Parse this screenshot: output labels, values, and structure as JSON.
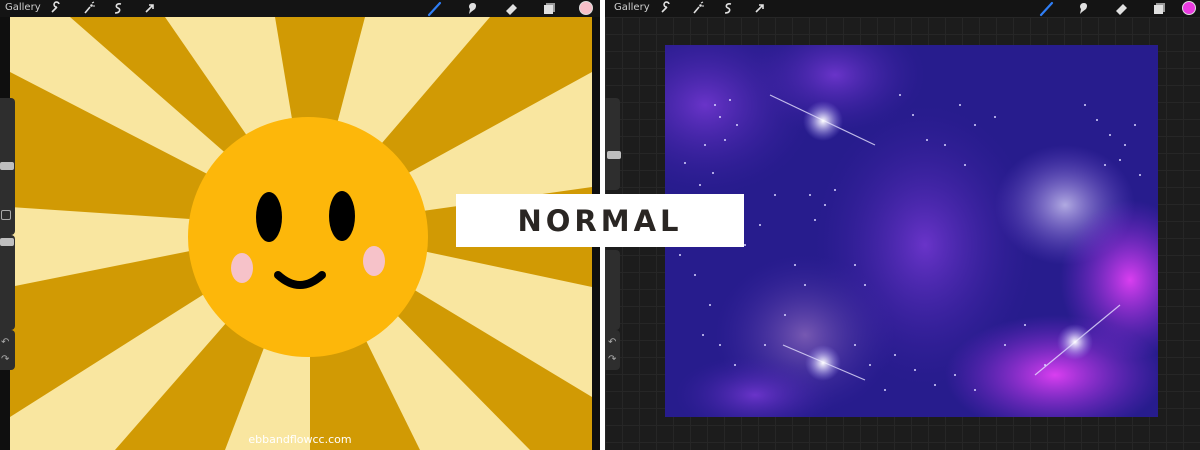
{
  "left_app": {
    "toolbar": {
      "gallery_label": "Gallery",
      "left_tools": [
        "wrench-icon",
        "magic-wand-icon",
        "selection-icon",
        "transform-arrow-icon"
      ],
      "right_tools": [
        "brush-icon",
        "smudge-icon",
        "eraser-icon",
        "layers-icon"
      ],
      "current_color": "#f7bfc8"
    },
    "canvas": {
      "background_color": "#d19a04",
      "ray_color": "#f9e6a0",
      "sun_color": "#fdb70a",
      "eye_color": "#000000",
      "cheek_color": "#f6c2c9"
    },
    "watermark": "ebbandflowcc.com"
  },
  "right_app": {
    "toolbar": {
      "gallery_label": "Gallery",
      "left_tools": [
        "wrench-icon",
        "magic-wand-icon",
        "selection-icon",
        "transform-arrow-icon"
      ],
      "right_tools": [
        "brush-icon",
        "smudge-icon",
        "eraser-icon",
        "layers-icon"
      ],
      "current_color": "#e93be0"
    },
    "canvas": {
      "base_color": "#2a1f9a",
      "nebula_colors": [
        "#6b2fd6",
        "#d63ef2",
        "#b6b0e8"
      ]
    }
  },
  "blend_mode_label": "NORMAL"
}
